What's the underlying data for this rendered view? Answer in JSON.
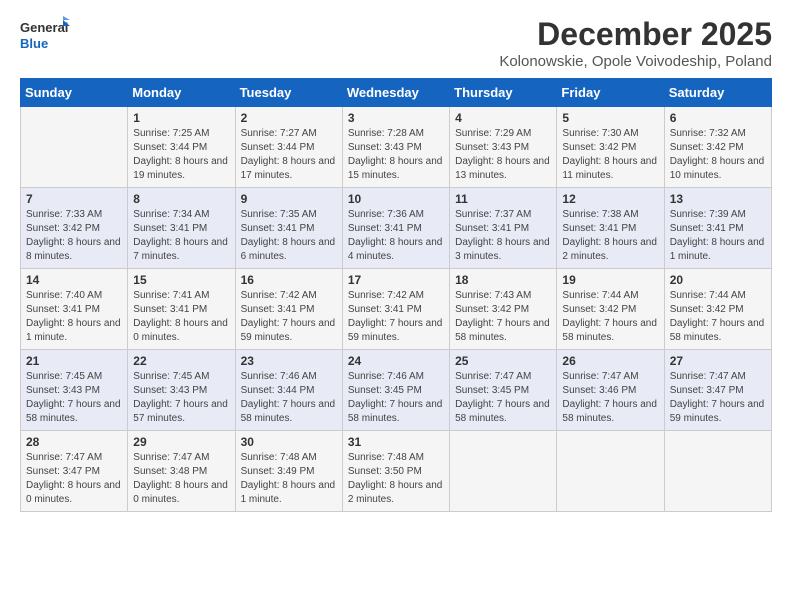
{
  "header": {
    "logo_line1": "General",
    "logo_line2": "Blue",
    "month_year": "December 2025",
    "location": "Kolonowskie, Opole Voivodeship, Poland"
  },
  "days_of_week": [
    "Sunday",
    "Monday",
    "Tuesday",
    "Wednesday",
    "Thursday",
    "Friday",
    "Saturday"
  ],
  "weeks": [
    [
      {
        "day": "",
        "sunrise": "",
        "sunset": "",
        "daylight": ""
      },
      {
        "day": "1",
        "sunrise": "Sunrise: 7:25 AM",
        "sunset": "Sunset: 3:44 PM",
        "daylight": "Daylight: 8 hours and 19 minutes."
      },
      {
        "day": "2",
        "sunrise": "Sunrise: 7:27 AM",
        "sunset": "Sunset: 3:44 PM",
        "daylight": "Daylight: 8 hours and 17 minutes."
      },
      {
        "day": "3",
        "sunrise": "Sunrise: 7:28 AM",
        "sunset": "Sunset: 3:43 PM",
        "daylight": "Daylight: 8 hours and 15 minutes."
      },
      {
        "day": "4",
        "sunrise": "Sunrise: 7:29 AM",
        "sunset": "Sunset: 3:43 PM",
        "daylight": "Daylight: 8 hours and 13 minutes."
      },
      {
        "day": "5",
        "sunrise": "Sunrise: 7:30 AM",
        "sunset": "Sunset: 3:42 PM",
        "daylight": "Daylight: 8 hours and 11 minutes."
      },
      {
        "day": "6",
        "sunrise": "Sunrise: 7:32 AM",
        "sunset": "Sunset: 3:42 PM",
        "daylight": "Daylight: 8 hours and 10 minutes."
      }
    ],
    [
      {
        "day": "7",
        "sunrise": "Sunrise: 7:33 AM",
        "sunset": "Sunset: 3:42 PM",
        "daylight": "Daylight: 8 hours and 8 minutes."
      },
      {
        "day": "8",
        "sunrise": "Sunrise: 7:34 AM",
        "sunset": "Sunset: 3:41 PM",
        "daylight": "Daylight: 8 hours and 7 minutes."
      },
      {
        "day": "9",
        "sunrise": "Sunrise: 7:35 AM",
        "sunset": "Sunset: 3:41 PM",
        "daylight": "Daylight: 8 hours and 6 minutes."
      },
      {
        "day": "10",
        "sunrise": "Sunrise: 7:36 AM",
        "sunset": "Sunset: 3:41 PM",
        "daylight": "Daylight: 8 hours and 4 minutes."
      },
      {
        "day": "11",
        "sunrise": "Sunrise: 7:37 AM",
        "sunset": "Sunset: 3:41 PM",
        "daylight": "Daylight: 8 hours and 3 minutes."
      },
      {
        "day": "12",
        "sunrise": "Sunrise: 7:38 AM",
        "sunset": "Sunset: 3:41 PM",
        "daylight": "Daylight: 8 hours and 2 minutes."
      },
      {
        "day": "13",
        "sunrise": "Sunrise: 7:39 AM",
        "sunset": "Sunset: 3:41 PM",
        "daylight": "Daylight: 8 hours and 1 minute."
      }
    ],
    [
      {
        "day": "14",
        "sunrise": "Sunrise: 7:40 AM",
        "sunset": "Sunset: 3:41 PM",
        "daylight": "Daylight: 8 hours and 1 minute."
      },
      {
        "day": "15",
        "sunrise": "Sunrise: 7:41 AM",
        "sunset": "Sunset: 3:41 PM",
        "daylight": "Daylight: 8 hours and 0 minutes."
      },
      {
        "day": "16",
        "sunrise": "Sunrise: 7:42 AM",
        "sunset": "Sunset: 3:41 PM",
        "daylight": "Daylight: 7 hours and 59 minutes."
      },
      {
        "day": "17",
        "sunrise": "Sunrise: 7:42 AM",
        "sunset": "Sunset: 3:41 PM",
        "daylight": "Daylight: 7 hours and 59 minutes."
      },
      {
        "day": "18",
        "sunrise": "Sunrise: 7:43 AM",
        "sunset": "Sunset: 3:42 PM",
        "daylight": "Daylight: 7 hours and 58 minutes."
      },
      {
        "day": "19",
        "sunrise": "Sunrise: 7:44 AM",
        "sunset": "Sunset: 3:42 PM",
        "daylight": "Daylight: 7 hours and 58 minutes."
      },
      {
        "day": "20",
        "sunrise": "Sunrise: 7:44 AM",
        "sunset": "Sunset: 3:42 PM",
        "daylight": "Daylight: 7 hours and 58 minutes."
      }
    ],
    [
      {
        "day": "21",
        "sunrise": "Sunrise: 7:45 AM",
        "sunset": "Sunset: 3:43 PM",
        "daylight": "Daylight: 7 hours and 58 minutes."
      },
      {
        "day": "22",
        "sunrise": "Sunrise: 7:45 AM",
        "sunset": "Sunset: 3:43 PM",
        "daylight": "Daylight: 7 hours and 57 minutes."
      },
      {
        "day": "23",
        "sunrise": "Sunrise: 7:46 AM",
        "sunset": "Sunset: 3:44 PM",
        "daylight": "Daylight: 7 hours and 58 minutes."
      },
      {
        "day": "24",
        "sunrise": "Sunrise: 7:46 AM",
        "sunset": "Sunset: 3:45 PM",
        "daylight": "Daylight: 7 hours and 58 minutes."
      },
      {
        "day": "25",
        "sunrise": "Sunrise: 7:47 AM",
        "sunset": "Sunset: 3:45 PM",
        "daylight": "Daylight: 7 hours and 58 minutes."
      },
      {
        "day": "26",
        "sunrise": "Sunrise: 7:47 AM",
        "sunset": "Sunset: 3:46 PM",
        "daylight": "Daylight: 7 hours and 58 minutes."
      },
      {
        "day": "27",
        "sunrise": "Sunrise: 7:47 AM",
        "sunset": "Sunset: 3:47 PM",
        "daylight": "Daylight: 7 hours and 59 minutes."
      }
    ],
    [
      {
        "day": "28",
        "sunrise": "Sunrise: 7:47 AM",
        "sunset": "Sunset: 3:47 PM",
        "daylight": "Daylight: 8 hours and 0 minutes."
      },
      {
        "day": "29",
        "sunrise": "Sunrise: 7:47 AM",
        "sunset": "Sunset: 3:48 PM",
        "daylight": "Daylight: 8 hours and 0 minutes."
      },
      {
        "day": "30",
        "sunrise": "Sunrise: 7:48 AM",
        "sunset": "Sunset: 3:49 PM",
        "daylight": "Daylight: 8 hours and 1 minute."
      },
      {
        "day": "31",
        "sunrise": "Sunrise: 7:48 AM",
        "sunset": "Sunset: 3:50 PM",
        "daylight": "Daylight: 8 hours and 2 minutes."
      },
      {
        "day": "",
        "sunrise": "",
        "sunset": "",
        "daylight": ""
      },
      {
        "day": "",
        "sunrise": "",
        "sunset": "",
        "daylight": ""
      },
      {
        "day": "",
        "sunrise": "",
        "sunset": "",
        "daylight": ""
      }
    ]
  ]
}
